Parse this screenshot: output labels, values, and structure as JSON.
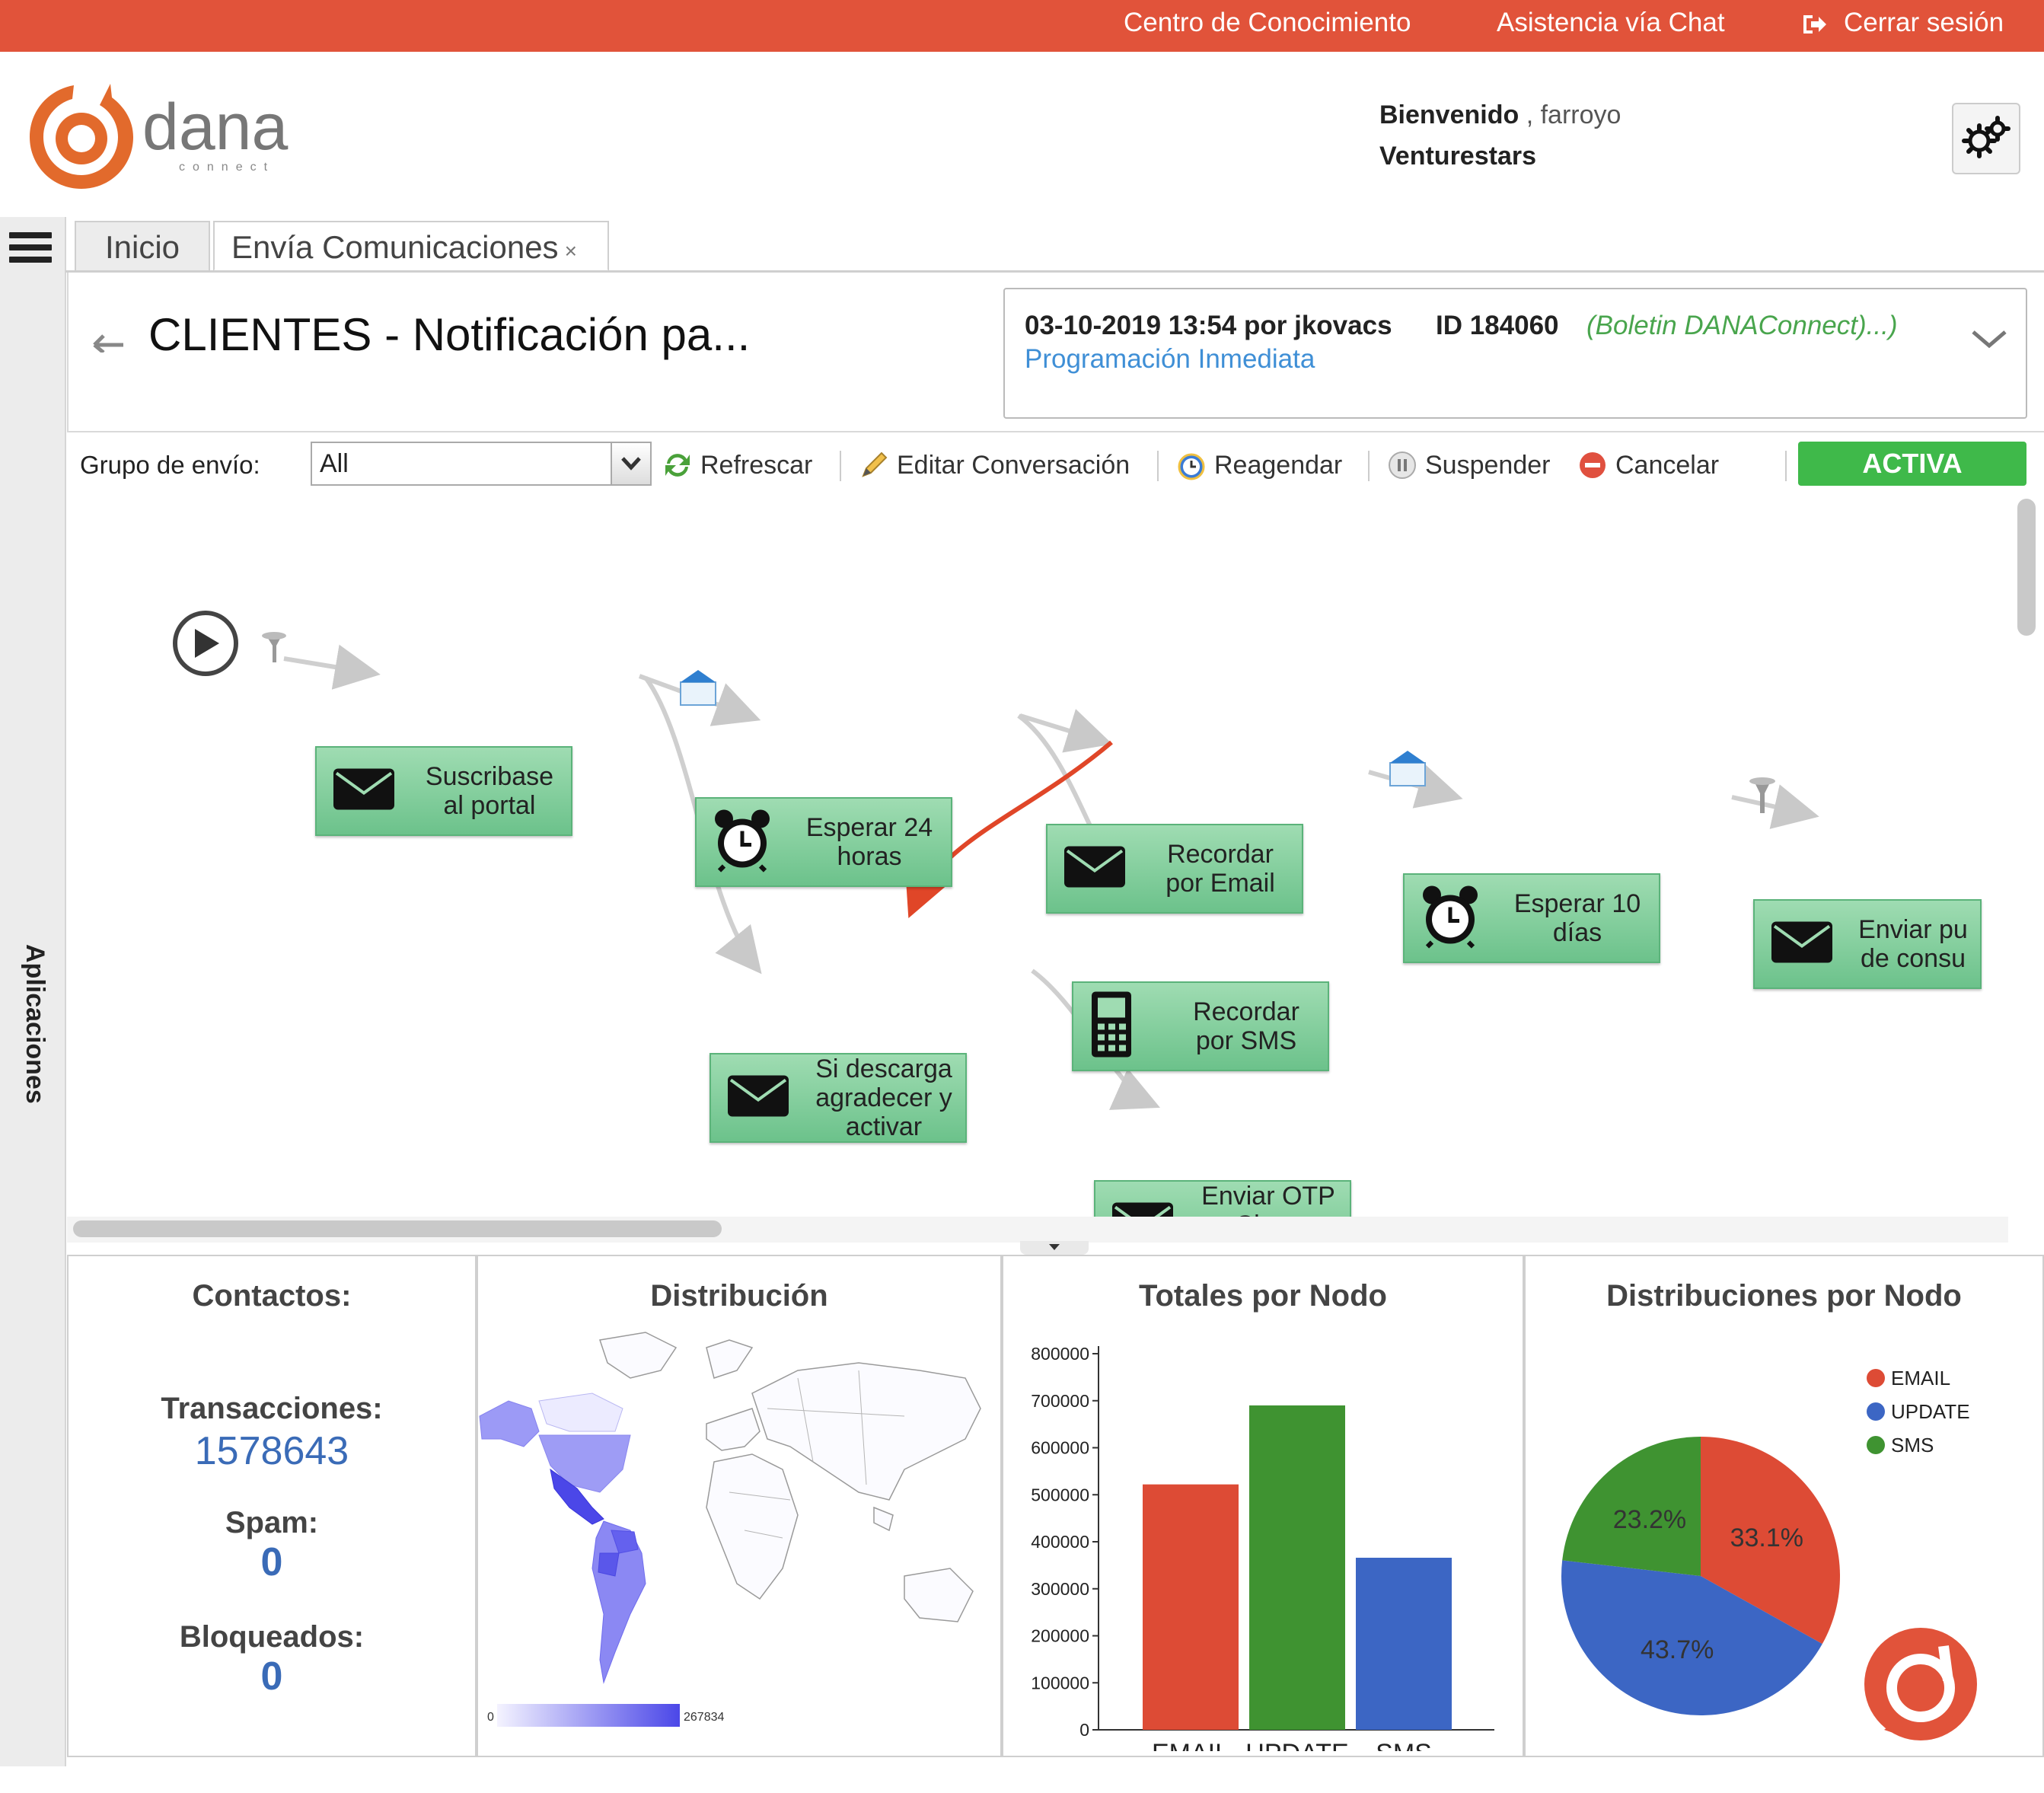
{
  "topbar": {
    "links": [
      "Centro de Conocimiento",
      "Asistencia vía Chat",
      "Cerrar sesión"
    ]
  },
  "header": {
    "logo_text": "dana",
    "logo_sub": "connect",
    "welcome_label": "Bienvenido",
    "user": ", farroyo",
    "company": "Venturestars"
  },
  "sidebar": {
    "vertical_label": "Aplicaciones"
  },
  "tabs": [
    {
      "label": "Inicio"
    },
    {
      "label": "Envía Comunicaciones",
      "close": "×"
    }
  ],
  "page": {
    "title": "CLIENTES - Notificación pa...",
    "info": {
      "datetime": "03-10-2019 13:54 por jkovacs",
      "id": "ID 184060",
      "template": "(Boletin DANAConnect)...)",
      "schedule": "Programación Inmediata"
    }
  },
  "toolbar": {
    "group_label": "Grupo de envío:",
    "group_value": "All",
    "refresh": "Refrescar",
    "edit": "Editar Conversación",
    "reschedule": "Reagendar",
    "suspend": "Suspender",
    "cancel": "Cancelar",
    "status": "ACTIVA"
  },
  "flow": {
    "nodes": [
      {
        "id": "n1",
        "type": "email",
        "label": "Suscribase al portal"
      },
      {
        "id": "n2",
        "type": "wait",
        "label": "Esperar 24 horas"
      },
      {
        "id": "n3",
        "type": "email",
        "label": "Recordar por Email"
      },
      {
        "id": "n4",
        "type": "sms",
        "label": "Recordar por SMS"
      },
      {
        "id": "n5",
        "type": "wait",
        "label": "Esperar 10 días"
      },
      {
        "id": "n6",
        "type": "email",
        "label": "Enviar pu de consu"
      },
      {
        "id": "n7",
        "type": "email",
        "label": "Si descarga agradecer y activar"
      },
      {
        "id": "n8",
        "type": "email",
        "label": "Enviar OTP Clave Temporal"
      }
    ]
  },
  "stats": {
    "title": "Contactos:",
    "transactions_label": "Transacciones:",
    "transactions": "1578643",
    "spam_label": "Spam:",
    "spam": "0",
    "blocked_label": "Bloqueados:",
    "blocked": "0"
  },
  "map": {
    "title": "Distribución",
    "legend_min": "0",
    "legend_max": "267834",
    "color_low": "#ecebff",
    "color_high": "#4b47e8"
  },
  "chart_data": [
    {
      "type": "bar",
      "title": "Totales por Nodo",
      "categories": [
        "EMAIL",
        "UPDATE",
        "SMS"
      ],
      "values": [
        522000,
        690000,
        366000
      ],
      "colors": [
        "#dd4b35",
        "#3f9331",
        "#3c66c4"
      ],
      "ylim": [
        0,
        800000
      ],
      "yticks": [
        0,
        100000,
        200000,
        300000,
        400000,
        500000,
        600000,
        700000,
        800000
      ]
    },
    {
      "type": "pie",
      "title": "Distribuciones por Nodo",
      "categories": [
        "EMAIL",
        "UPDATE",
        "SMS"
      ],
      "values": [
        33.1,
        43.7,
        23.2
      ],
      "labels": [
        "33.1%",
        "43.7%",
        "23.2%"
      ],
      "colors": [
        "#dd4b35",
        "#3c66c4",
        "#3f9331"
      ],
      "legend_position": "top-right"
    }
  ]
}
